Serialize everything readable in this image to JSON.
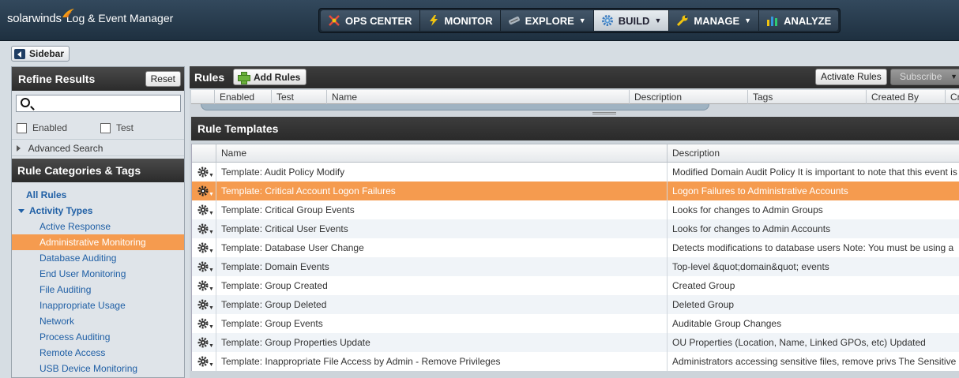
{
  "brand": {
    "logo_text": "solarwinds",
    "product": "Log & Event Manager"
  },
  "nav": [
    {
      "label": "OPS CENTER",
      "icon": "ops-center-icon",
      "caret": false,
      "active": false
    },
    {
      "label": "MONITOR",
      "icon": "lightning-icon",
      "caret": false,
      "active": false
    },
    {
      "label": "EXPLORE",
      "icon": "explore-icon",
      "caret": true,
      "active": false
    },
    {
      "label": "BUILD",
      "icon": "gear-icon",
      "caret": true,
      "active": true
    },
    {
      "label": "MANAGE",
      "icon": "wrench-icon",
      "caret": true,
      "active": false
    },
    {
      "label": "ANALYZE",
      "icon": "bar-chart-icon",
      "caret": false,
      "active": false
    }
  ],
  "sidebar_toggle": {
    "label": "Sidebar"
  },
  "refine": {
    "title": "Refine Results",
    "reset_label": "Reset",
    "search_value": "",
    "filters": [
      {
        "label": "Enabled",
        "checked": false
      },
      {
        "label": "Test",
        "checked": false
      }
    ],
    "advanced_label": "Advanced Search"
  },
  "categories": {
    "title": "Rule Categories & Tags",
    "all_label": "All Rules",
    "group_label": "Activity Types",
    "items": [
      "Active Response",
      "Administrative Monitoring",
      "Database Auditing",
      "End User Monitoring",
      "File Auditing",
      "Inappropriate Usage",
      "Network",
      "Process Auditing",
      "Remote Access",
      "USB Device Monitoring"
    ],
    "selected_index": 1
  },
  "rules": {
    "title": "Rules",
    "add_label": "Add Rules",
    "activate_label": "Activate Rules",
    "subscribe_label": "Subscribe",
    "columns": [
      "Enabled",
      "Test",
      "Name",
      "Description",
      "Tags",
      "Created By",
      "Cr"
    ]
  },
  "templates": {
    "title": "Rule Templates",
    "columns": {
      "name": "Name",
      "description": "Description"
    },
    "rows": [
      {
        "name": "Template: Audit Policy Modify",
        "description": "Modified Domain Audit Policy It is important to note that this event is"
      },
      {
        "name": "Template: Critical Account Logon Failures",
        "description": "Logon Failures to Administrative Accounts"
      },
      {
        "name": "Template: Critical Group Events",
        "description": "Looks for changes to Admin Groups"
      },
      {
        "name": "Template: Critical User Events",
        "description": "Looks for changes to Admin Accounts"
      },
      {
        "name": "Template: Database User Change",
        "description": "Detects modifications to database users Note: You must be using a"
      },
      {
        "name": "Template: Domain Events",
        "description": "Top-level &quot;domain&quot; events"
      },
      {
        "name": "Template: Group Created",
        "description": "Created Group"
      },
      {
        "name": "Template: Group Deleted",
        "description": "Deleted Group"
      },
      {
        "name": "Template: Group Events",
        "description": "Auditable Group Changes"
      },
      {
        "name": "Template: Group Properties Update",
        "description": "OU Properties (Location, Name, Linked GPOs, etc) Updated"
      },
      {
        "name": "Template: Inappropriate File Access by Admin - Remove Privileges",
        "description": "Administrators accessing sensitive files, remove privs The Sensitive"
      }
    ],
    "selected_index": 1
  },
  "colors": {
    "selected": "#f59b4f",
    "link": "#1f5fa5",
    "header_dark": "#2b2b2b",
    "topbar": "#1e3040"
  }
}
